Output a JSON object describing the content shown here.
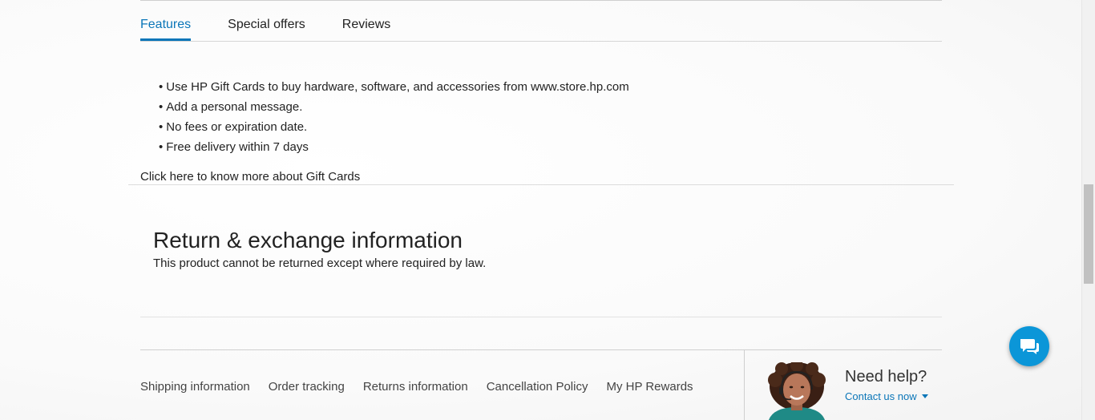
{
  "tabs": [
    {
      "label": "Features",
      "active": true
    },
    {
      "label": "Special offers",
      "active": false
    },
    {
      "label": "Reviews",
      "active": false
    }
  ],
  "features": {
    "items": [
      "Use HP Gift Cards to buy hardware, software, and accessories from www.store.hp.com",
      "Add a personal message.",
      "No fees or expiration date.",
      "Free delivery within 7 days"
    ],
    "more_link": "Click here to know more about Gift Cards"
  },
  "returns": {
    "title": "Return & exchange information",
    "text": "This product cannot be returned except where required by law."
  },
  "footer": {
    "links": [
      "Shipping information",
      "Order tracking",
      "Returns information",
      "Cancellation Policy",
      "My HP Rewards"
    ]
  },
  "help": {
    "title": "Need help?",
    "contact_label": "Contact us now",
    "avatar_icon": "support-agent-avatar",
    "caret_icon": "caret-down-icon"
  },
  "chat": {
    "icon": "chat-bubbles-icon",
    "color": "#0b96d8"
  },
  "colors": {
    "accent": "#0b76b8"
  }
}
